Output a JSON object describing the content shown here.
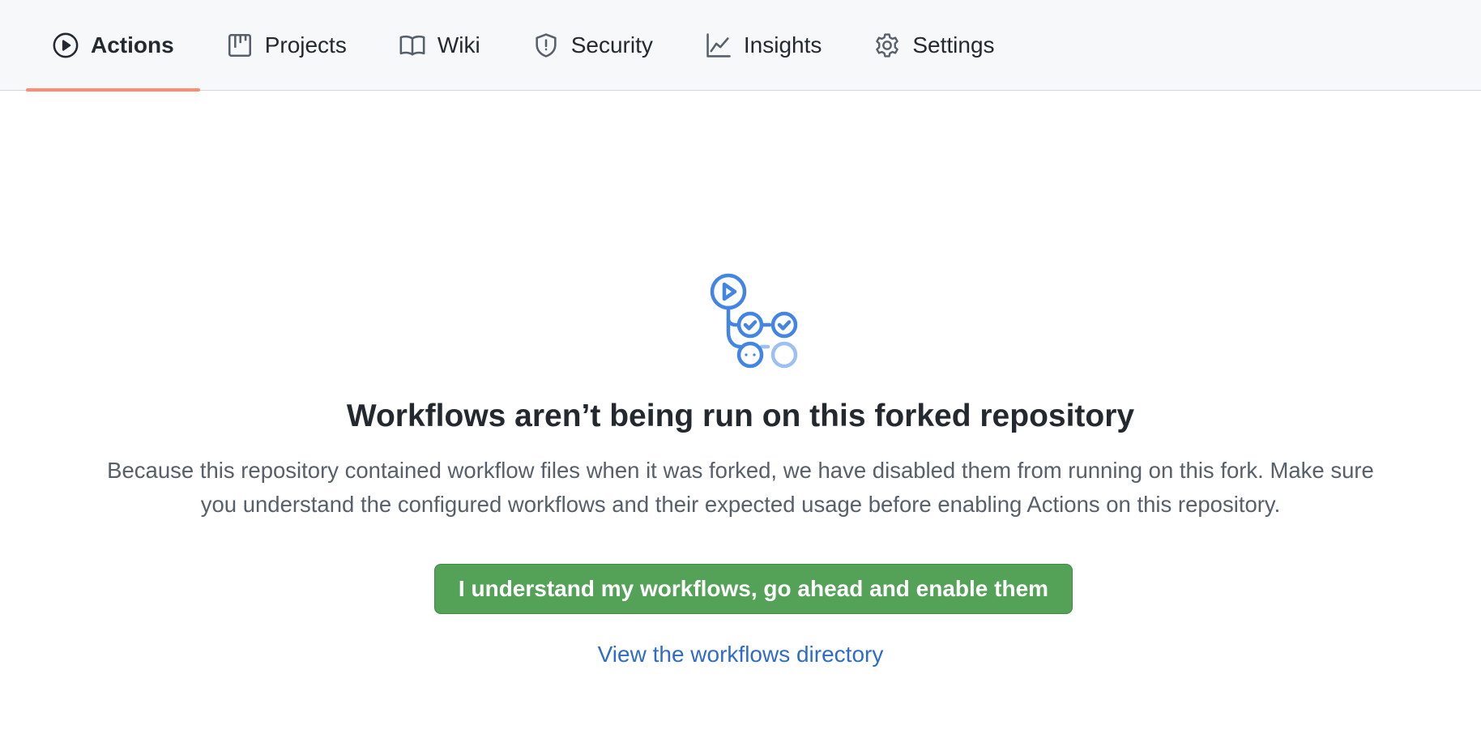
{
  "tabs": [
    {
      "label": "Actions",
      "icon": "play-circle-icon",
      "selected": true
    },
    {
      "label": "Projects",
      "icon": "project-board-icon",
      "selected": false
    },
    {
      "label": "Wiki",
      "icon": "book-icon",
      "selected": false
    },
    {
      "label": "Security",
      "icon": "shield-icon",
      "selected": false
    },
    {
      "label": "Insights",
      "icon": "graph-icon",
      "selected": false
    },
    {
      "label": "Settings",
      "icon": "gear-icon",
      "selected": false
    }
  ],
  "empty_state": {
    "icon": "workflow-icon",
    "title": "Workflows aren’t being run on this forked repository",
    "description": "Because this repository contained workflow files when it was forked, we have disabled them from running on this fork. Make sure you understand the configured workflows and their expected usage before enabling Actions on this repository.",
    "enable_button_label": "I understand my workflows, go ahead and enable them",
    "directory_link_label": "View the workflows directory"
  },
  "colors": {
    "selected_underline": "#fd8c73",
    "primary_button": "#53a257",
    "link": "#2f6bc8",
    "workflow_icon": "#4285e4"
  }
}
